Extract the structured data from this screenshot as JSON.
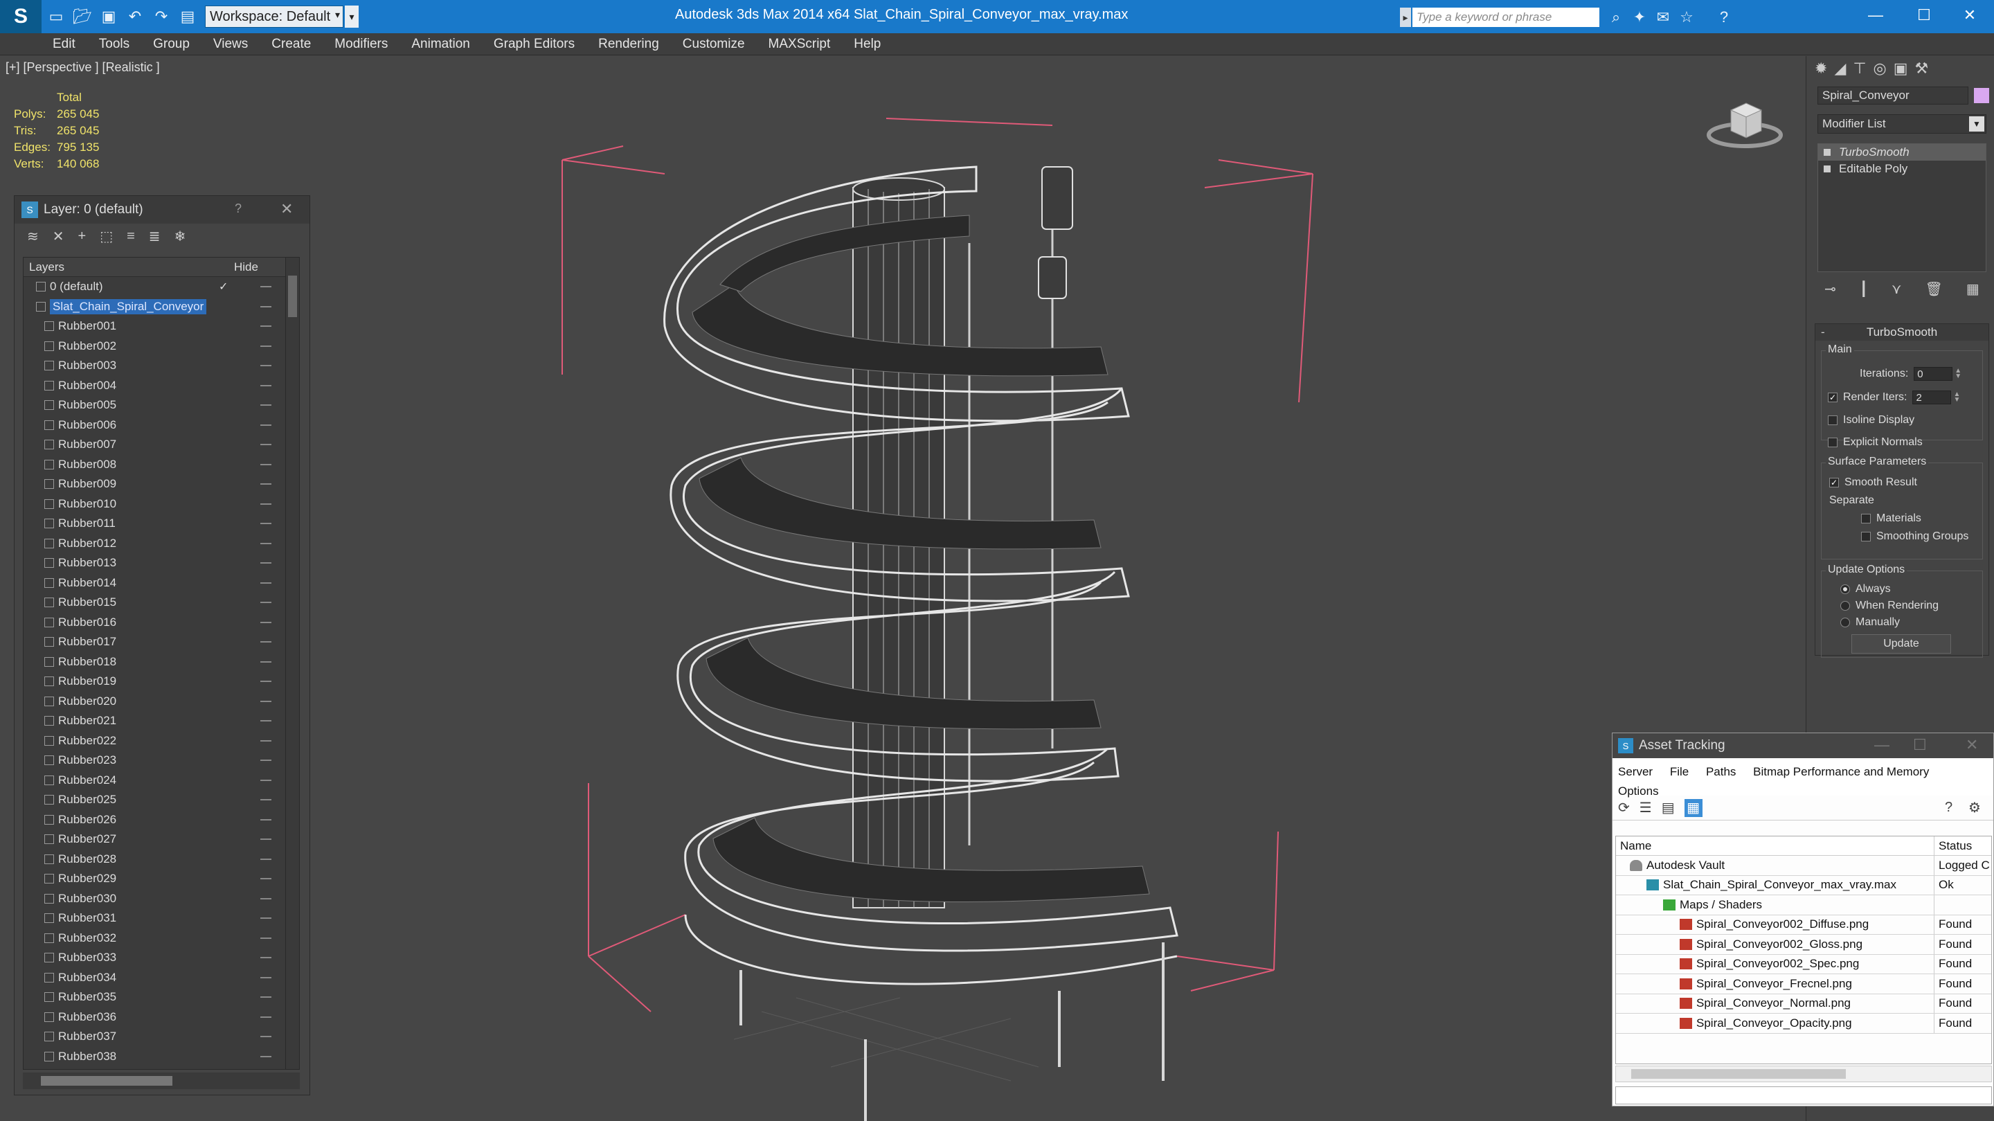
{
  "app": {
    "workspace_label": "Workspace: Default",
    "title": "Autodesk 3ds Max  2014 x64      Slat_Chain_Spiral_Conveyor_max_vray.max",
    "search_placeholder": "Type a keyword or phrase"
  },
  "menu": [
    "Edit",
    "Tools",
    "Group",
    "Views",
    "Create",
    "Modifiers",
    "Animation",
    "Graph Editors",
    "Rendering",
    "Customize",
    "MAXScript",
    "Help"
  ],
  "viewport": {
    "label": "[+] [Perspective ] [Realistic ]",
    "stats": {
      "header": "Total",
      "rows": [
        {
          "k": "Polys:",
          "v": "265 045"
        },
        {
          "k": "Tris:",
          "v": "265 045"
        },
        {
          "k": "Edges:",
          "v": "795 135"
        },
        {
          "k": "Verts:",
          "v": "140 068"
        }
      ]
    }
  },
  "layer_dialog": {
    "title": "Layer: 0 (default)",
    "help": "?",
    "close": "✕",
    "col_layers": "Layers",
    "col_hide": "Hide",
    "items": [
      {
        "name": "0 (default)",
        "level": 1,
        "check": "✓"
      },
      {
        "name": "Slat_Chain_Spiral_Conveyor",
        "level": 1,
        "selected": true
      },
      {
        "name": "Rubber001",
        "level": 2
      },
      {
        "name": "Rubber002",
        "level": 2
      },
      {
        "name": "Rubber003",
        "level": 2
      },
      {
        "name": "Rubber004",
        "level": 2
      },
      {
        "name": "Rubber005",
        "level": 2
      },
      {
        "name": "Rubber006",
        "level": 2
      },
      {
        "name": "Rubber007",
        "level": 2
      },
      {
        "name": "Rubber008",
        "level": 2
      },
      {
        "name": "Rubber009",
        "level": 2
      },
      {
        "name": "Rubber010",
        "level": 2
      },
      {
        "name": "Rubber011",
        "level": 2
      },
      {
        "name": "Rubber012",
        "level": 2
      },
      {
        "name": "Rubber013",
        "level": 2
      },
      {
        "name": "Rubber014",
        "level": 2
      },
      {
        "name": "Rubber015",
        "level": 2
      },
      {
        "name": "Rubber016",
        "level": 2
      },
      {
        "name": "Rubber017",
        "level": 2
      },
      {
        "name": "Rubber018",
        "level": 2
      },
      {
        "name": "Rubber019",
        "level": 2
      },
      {
        "name": "Rubber020",
        "level": 2
      },
      {
        "name": "Rubber021",
        "level": 2
      },
      {
        "name": "Rubber022",
        "level": 2
      },
      {
        "name": "Rubber023",
        "level": 2
      },
      {
        "name": "Rubber024",
        "level": 2
      },
      {
        "name": "Rubber025",
        "level": 2
      },
      {
        "name": "Rubber026",
        "level": 2
      },
      {
        "name": "Rubber027",
        "level": 2
      },
      {
        "name": "Rubber028",
        "level": 2
      },
      {
        "name": "Rubber029",
        "level": 2
      },
      {
        "name": "Rubber030",
        "level": 2
      },
      {
        "name": "Rubber031",
        "level": 2
      },
      {
        "name": "Rubber032",
        "level": 2
      },
      {
        "name": "Rubber033",
        "level": 2
      },
      {
        "name": "Rubber034",
        "level": 2
      },
      {
        "name": "Rubber035",
        "level": 2
      },
      {
        "name": "Rubber036",
        "level": 2
      },
      {
        "name": "Rubber037",
        "level": 2
      },
      {
        "name": "Rubber038",
        "level": 2
      }
    ]
  },
  "command_panel": {
    "object_name": "Spiral_Conveyor",
    "object_color": "#d9a8f0",
    "modifier_list": "Modifier List",
    "stack": [
      {
        "name": "TurboSmooth",
        "selected": true
      },
      {
        "name": "Editable Poly",
        "selected": false
      }
    ],
    "turbosmooth": {
      "title": "TurboSmooth",
      "collapse": "-",
      "main_label": "Main",
      "iterations_label": "Iterations:",
      "iterations_value": "0",
      "render_iters_label": "Render Iters:",
      "render_iters_value": "2",
      "isoline_label": "Isoline Display",
      "explicit_normals_label": "Explicit Normals",
      "surface_label": "Surface Parameters",
      "smooth_result_label": "Smooth Result",
      "separate_label": "Separate",
      "materials_label": "Materials",
      "smoothing_groups_label": "Smoothing Groups",
      "update_options_label": "Update Options",
      "always_label": "Always",
      "when_rendering_label": "When Rendering",
      "manually_label": "Manually",
      "update_button": "Update"
    }
  },
  "asset_tracking": {
    "title": "Asset Tracking",
    "menu": [
      "Server",
      "File",
      "Paths",
      "Bitmap Performance and Memory"
    ],
    "menu2": "Options",
    "col_name": "Name",
    "col_status": "Status",
    "rows": [
      {
        "name": "Autodesk Vault",
        "status": "Logged C",
        "indent": 1,
        "icon": "vault"
      },
      {
        "name": "Slat_Chain_Spiral_Conveyor_max_vray.max",
        "status": "Ok",
        "indent": 2,
        "icon": "max"
      },
      {
        "name": "Maps / Shaders",
        "status": "",
        "indent": 3,
        "icon": "fold"
      },
      {
        "name": "Spiral_Conveyor002_Diffuse.png",
        "status": "Found",
        "indent": 4,
        "icon": "png"
      },
      {
        "name": "Spiral_Conveyor002_Gloss.png",
        "status": "Found",
        "indent": 4,
        "icon": "png"
      },
      {
        "name": "Spiral_Conveyor002_Spec.png",
        "status": "Found",
        "indent": 4,
        "icon": "png"
      },
      {
        "name": "Spiral_Conveyor_Frecnel.png",
        "status": "Found",
        "indent": 4,
        "icon": "png"
      },
      {
        "name": "Spiral_Conveyor_Normal.png",
        "status": "Found",
        "indent": 4,
        "icon": "png"
      },
      {
        "name": "Spiral_Conveyor_Opacity.png",
        "status": "Found",
        "indent": 4,
        "icon": "png"
      }
    ]
  }
}
